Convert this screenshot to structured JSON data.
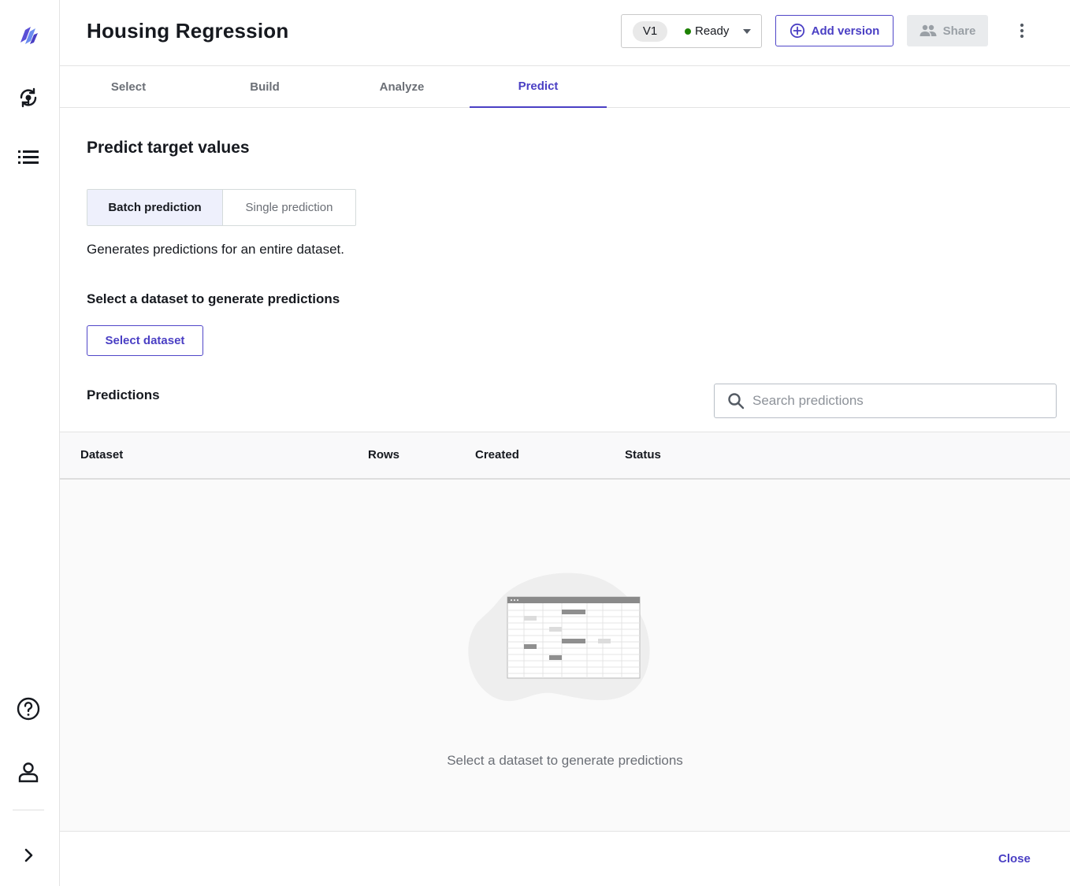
{
  "rail": {
    "icons": [
      "logo-icon",
      "model-icon",
      "list-icon",
      "help-icon",
      "user-icon",
      "chevron-right-icon"
    ]
  },
  "header": {
    "title": "Housing Regression",
    "version": "V1",
    "status": "Ready",
    "add_version_label": "Add version",
    "share_label": "Share"
  },
  "tabs": [
    {
      "label": "Select"
    },
    {
      "label": "Build"
    },
    {
      "label": "Analyze"
    },
    {
      "label": "Predict"
    }
  ],
  "main": {
    "section_title": "Predict target values",
    "segments": {
      "batch_label": "Batch prediction",
      "single_label": "Single prediction"
    },
    "description": "Generates predictions for an entire dataset.",
    "select_title": "Select a dataset to generate predictions",
    "select_button": "Select dataset"
  },
  "predictions": {
    "title": "Predictions",
    "search_placeholder": "Search predictions",
    "columns": [
      "Dataset",
      "Rows",
      "Created",
      "Status"
    ],
    "empty_text": "Select a dataset to generate predictions"
  },
  "footer": {
    "close_label": "Close"
  },
  "colors": {
    "accent": "#4a3fc4",
    "status_ready": "#1d8102"
  }
}
